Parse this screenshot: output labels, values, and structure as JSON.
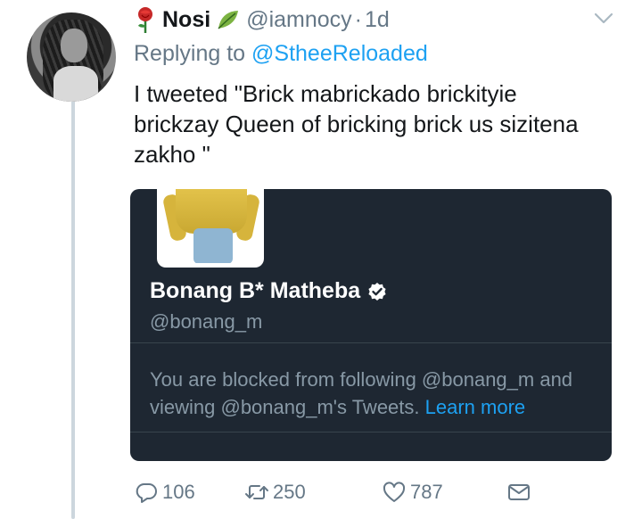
{
  "tweet": {
    "author_name": "Nosi",
    "handle": "@iamnocy",
    "separator": "·",
    "time": "1d",
    "replying_prefix": "Replying to",
    "replying_to": "@StheeReloaded",
    "text": "I tweeted \"Brick mabrickado brickityie brickzay Queen of bricking brick us sizitena zakho \""
  },
  "quote_card": {
    "name": "Bonang B* Matheba",
    "handle": "@bonang_m",
    "message": "You are blocked from following @bonang_m and viewing @bonang_m's Tweets.",
    "learn_more": "Learn more"
  },
  "actions": {
    "replies": "106",
    "retweets": "250",
    "likes": "787"
  },
  "colors": {
    "accent": "#1da1f2",
    "secondary_text": "#657786",
    "card_background": "#1e2732",
    "thread_line": "#ccd6dd"
  },
  "icons": [
    "rose-icon",
    "leaf-icon",
    "chevron-down-icon",
    "verified-icon",
    "reply-icon",
    "retweet-icon",
    "like-icon",
    "direct-message-icon"
  ]
}
